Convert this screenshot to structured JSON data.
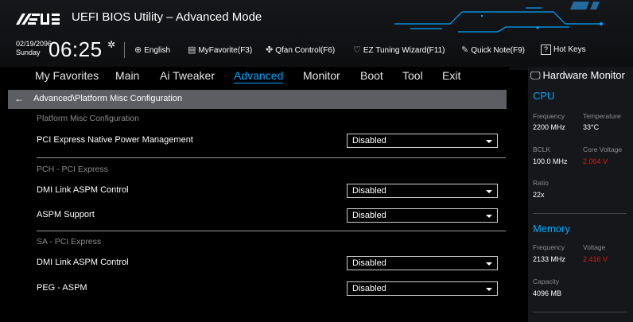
{
  "header": {
    "title": "UEFI BIOS Utility – Advanced Mode",
    "date": "02/19/2096",
    "day": "Sunday",
    "time": "06:25",
    "tools": [
      {
        "label": "English",
        "icon": "globe-icon"
      },
      {
        "label": "MyFavorite(F3)",
        "icon": "favorite-icon"
      },
      {
        "label": "Qfan Control(F6)",
        "icon": "fan-icon"
      },
      {
        "label": "EZ Tuning Wizard(F11)",
        "icon": "bulb-icon"
      },
      {
        "label": "Quick Note(F9)",
        "icon": "note-icon"
      },
      {
        "label": "Hot Keys",
        "icon": "hotkey-icon"
      }
    ],
    "hotkey_glyph": "?"
  },
  "tabs": [
    "My Favorites",
    "Main",
    "Ai Tweaker",
    "Advanced",
    "Monitor",
    "Boot",
    "Tool",
    "Exit"
  ],
  "active_tab": "Advanced",
  "breadcrumb": "Advanced\\Platform Misc Configuration",
  "sections": {
    "platform": "Platform Misc Configuration",
    "pch": "PCH - PCI Express",
    "sa": "SA - PCI Express"
  },
  "settings": [
    {
      "label": "PCI Express Native Power Management",
      "value": "Disabled"
    },
    {
      "label": "DMI Link ASPM Control",
      "value": "Disabled"
    },
    {
      "label": "ASPM Support",
      "value": "Disabled"
    },
    {
      "label": "DMI Link ASPM Control",
      "value": "Disabled"
    },
    {
      "label": "PEG - ASPM",
      "value": "Disabled"
    }
  ],
  "hw": {
    "title": "Hardware Monitor",
    "cpu": {
      "heading": "CPU",
      "frequency_label": "Frequency",
      "frequency": "2200 MHz",
      "temperature_label": "Temperature",
      "temperature": "33°C",
      "bclk_label": "BCLK",
      "bclk": "100.0 MHz",
      "core_voltage_label": "Core Voltage",
      "core_voltage": "2.064 V",
      "ratio_label": "Ratio",
      "ratio": "22x"
    },
    "memory": {
      "heading": "Memory",
      "frequency_label": "Frequency",
      "frequency": "2133 MHz",
      "voltage_label": "Voltage",
      "voltage": "2.416 V",
      "capacity_label": "Capacity",
      "capacity": "4096 MB"
    }
  },
  "colors": {
    "accent": "#00a6ff",
    "warning": "#e0190f",
    "crumb_bg": "#5c5e61",
    "panel_bg": "#15171a"
  }
}
